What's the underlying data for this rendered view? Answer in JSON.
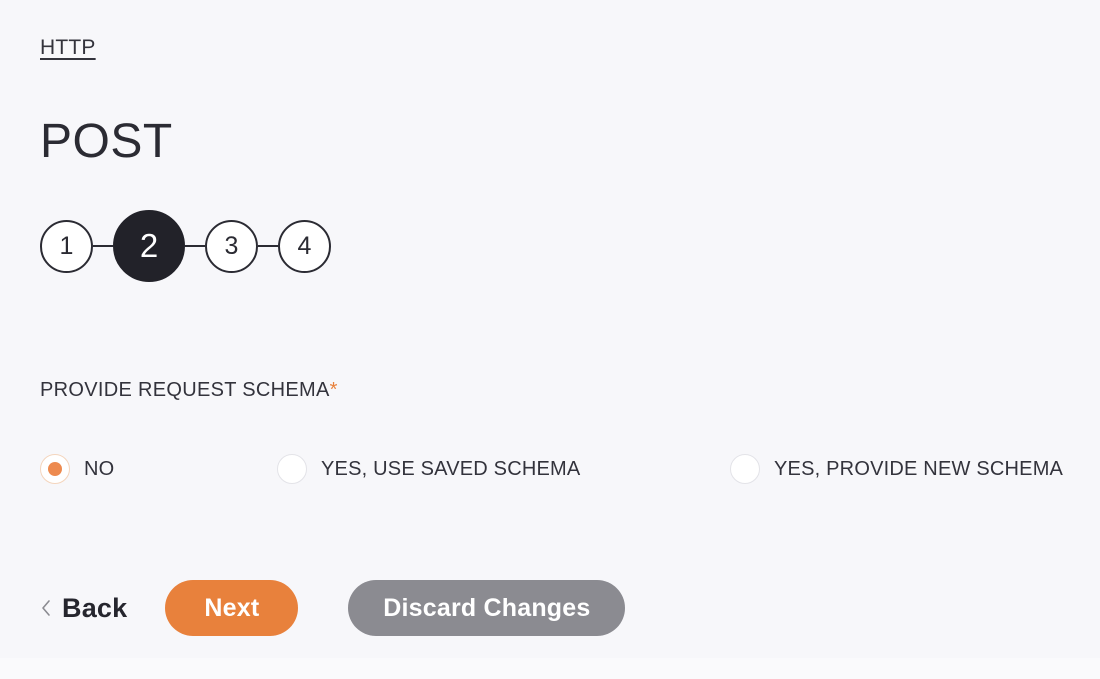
{
  "breadcrumb": {
    "label": "HTTP"
  },
  "header": {
    "title": "POST"
  },
  "stepper": {
    "current": 2,
    "steps": [
      {
        "label": "1",
        "active": false
      },
      {
        "label": "2",
        "active": true
      },
      {
        "label": "3",
        "active": false
      },
      {
        "label": "4",
        "active": false
      }
    ]
  },
  "form": {
    "field": {
      "label": "PROVIDE REQUEST SCHEMA",
      "required_marker": "*",
      "selected": "NO",
      "options": [
        {
          "label": "NO",
          "checked": true
        },
        {
          "label": "YES, USE SAVED SCHEMA",
          "checked": false
        },
        {
          "label": "YES, PROVIDE NEW SCHEMA",
          "checked": false
        }
      ]
    }
  },
  "actions": {
    "back_label": "Back",
    "back_icon": "chevron-left-icon",
    "next_label": "Next",
    "discard_label": "Discard Changes"
  },
  "colors": {
    "accent": "#e8813c",
    "radio_dot": "#ed8a4f",
    "dark": "#222229",
    "gray_button": "#8b8b91",
    "background": "#f7f7fa",
    "text": "#33333c"
  }
}
